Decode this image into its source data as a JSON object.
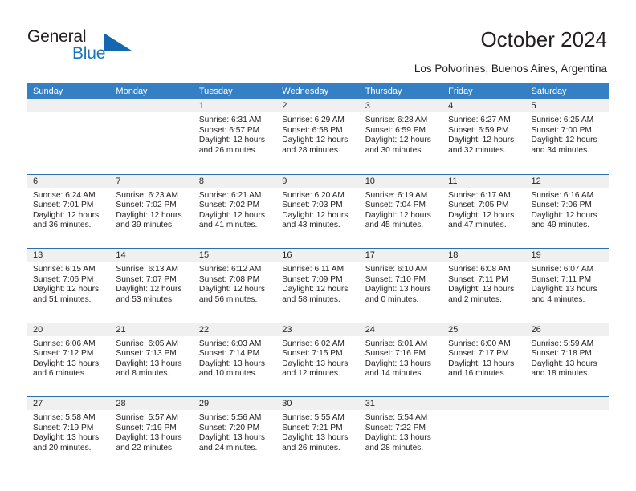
{
  "brand": {
    "name_top": "General",
    "name_bottom": "Blue",
    "triangle_color": "#1667b1",
    "blue_color": "#1b75bb"
  },
  "header": {
    "title": "October 2024",
    "subtitle": "Los Polvorines, Buenos Aires, Argentina"
  },
  "colors": {
    "header_blue": "#3580c4",
    "row_rule_blue": "#2c6fb0",
    "date_band_gray": "#f0f0f0",
    "text": "#231f20"
  },
  "calendar": {
    "weekdays": [
      "Sunday",
      "Monday",
      "Tuesday",
      "Wednesday",
      "Thursday",
      "Friday",
      "Saturday"
    ],
    "weeks": [
      [
        {
          "day": "",
          "sunrise": "",
          "sunset": "",
          "daylight": "",
          "daylight2": ""
        },
        {
          "day": "",
          "sunrise": "",
          "sunset": "",
          "daylight": "",
          "daylight2": ""
        },
        {
          "day": "1",
          "sunrise": "Sunrise: 6:31 AM",
          "sunset": "Sunset: 6:57 PM",
          "daylight": "Daylight: 12 hours",
          "daylight2": "and 26 minutes."
        },
        {
          "day": "2",
          "sunrise": "Sunrise: 6:29 AM",
          "sunset": "Sunset: 6:58 PM",
          "daylight": "Daylight: 12 hours",
          "daylight2": "and 28 minutes."
        },
        {
          "day": "3",
          "sunrise": "Sunrise: 6:28 AM",
          "sunset": "Sunset: 6:59 PM",
          "daylight": "Daylight: 12 hours",
          "daylight2": "and 30 minutes."
        },
        {
          "day": "4",
          "sunrise": "Sunrise: 6:27 AM",
          "sunset": "Sunset: 6:59 PM",
          "daylight": "Daylight: 12 hours",
          "daylight2": "and 32 minutes."
        },
        {
          "day": "5",
          "sunrise": "Sunrise: 6:25 AM",
          "sunset": "Sunset: 7:00 PM",
          "daylight": "Daylight: 12 hours",
          "daylight2": "and 34 minutes."
        }
      ],
      [
        {
          "day": "6",
          "sunrise": "Sunrise: 6:24 AM",
          "sunset": "Sunset: 7:01 PM",
          "daylight": "Daylight: 12 hours",
          "daylight2": "and 36 minutes."
        },
        {
          "day": "7",
          "sunrise": "Sunrise: 6:23 AM",
          "sunset": "Sunset: 7:02 PM",
          "daylight": "Daylight: 12 hours",
          "daylight2": "and 39 minutes."
        },
        {
          "day": "8",
          "sunrise": "Sunrise: 6:21 AM",
          "sunset": "Sunset: 7:02 PM",
          "daylight": "Daylight: 12 hours",
          "daylight2": "and 41 minutes."
        },
        {
          "day": "9",
          "sunrise": "Sunrise: 6:20 AM",
          "sunset": "Sunset: 7:03 PM",
          "daylight": "Daylight: 12 hours",
          "daylight2": "and 43 minutes."
        },
        {
          "day": "10",
          "sunrise": "Sunrise: 6:19 AM",
          "sunset": "Sunset: 7:04 PM",
          "daylight": "Daylight: 12 hours",
          "daylight2": "and 45 minutes."
        },
        {
          "day": "11",
          "sunrise": "Sunrise: 6:17 AM",
          "sunset": "Sunset: 7:05 PM",
          "daylight": "Daylight: 12 hours",
          "daylight2": "and 47 minutes."
        },
        {
          "day": "12",
          "sunrise": "Sunrise: 6:16 AM",
          "sunset": "Sunset: 7:06 PM",
          "daylight": "Daylight: 12 hours",
          "daylight2": "and 49 minutes."
        }
      ],
      [
        {
          "day": "13",
          "sunrise": "Sunrise: 6:15 AM",
          "sunset": "Sunset: 7:06 PM",
          "daylight": "Daylight: 12 hours",
          "daylight2": "and 51 minutes."
        },
        {
          "day": "14",
          "sunrise": "Sunrise: 6:13 AM",
          "sunset": "Sunset: 7:07 PM",
          "daylight": "Daylight: 12 hours",
          "daylight2": "and 53 minutes."
        },
        {
          "day": "15",
          "sunrise": "Sunrise: 6:12 AM",
          "sunset": "Sunset: 7:08 PM",
          "daylight": "Daylight: 12 hours",
          "daylight2": "and 56 minutes."
        },
        {
          "day": "16",
          "sunrise": "Sunrise: 6:11 AM",
          "sunset": "Sunset: 7:09 PM",
          "daylight": "Daylight: 12 hours",
          "daylight2": "and 58 minutes."
        },
        {
          "day": "17",
          "sunrise": "Sunrise: 6:10 AM",
          "sunset": "Sunset: 7:10 PM",
          "daylight": "Daylight: 13 hours",
          "daylight2": "and 0 minutes."
        },
        {
          "day": "18",
          "sunrise": "Sunrise: 6:08 AM",
          "sunset": "Sunset: 7:11 PM",
          "daylight": "Daylight: 13 hours",
          "daylight2": "and 2 minutes."
        },
        {
          "day": "19",
          "sunrise": "Sunrise: 6:07 AM",
          "sunset": "Sunset: 7:11 PM",
          "daylight": "Daylight: 13 hours",
          "daylight2": "and 4 minutes."
        }
      ],
      [
        {
          "day": "20",
          "sunrise": "Sunrise: 6:06 AM",
          "sunset": "Sunset: 7:12 PM",
          "daylight": "Daylight: 13 hours",
          "daylight2": "and 6 minutes."
        },
        {
          "day": "21",
          "sunrise": "Sunrise: 6:05 AM",
          "sunset": "Sunset: 7:13 PM",
          "daylight": "Daylight: 13 hours",
          "daylight2": "and 8 minutes."
        },
        {
          "day": "22",
          "sunrise": "Sunrise: 6:03 AM",
          "sunset": "Sunset: 7:14 PM",
          "daylight": "Daylight: 13 hours",
          "daylight2": "and 10 minutes."
        },
        {
          "day": "23",
          "sunrise": "Sunrise: 6:02 AM",
          "sunset": "Sunset: 7:15 PM",
          "daylight": "Daylight: 13 hours",
          "daylight2": "and 12 minutes."
        },
        {
          "day": "24",
          "sunrise": "Sunrise: 6:01 AM",
          "sunset": "Sunset: 7:16 PM",
          "daylight": "Daylight: 13 hours",
          "daylight2": "and 14 minutes."
        },
        {
          "day": "25",
          "sunrise": "Sunrise: 6:00 AM",
          "sunset": "Sunset: 7:17 PM",
          "daylight": "Daylight: 13 hours",
          "daylight2": "and 16 minutes."
        },
        {
          "day": "26",
          "sunrise": "Sunrise: 5:59 AM",
          "sunset": "Sunset: 7:18 PM",
          "daylight": "Daylight: 13 hours",
          "daylight2": "and 18 minutes."
        }
      ],
      [
        {
          "day": "27",
          "sunrise": "Sunrise: 5:58 AM",
          "sunset": "Sunset: 7:19 PM",
          "daylight": "Daylight: 13 hours",
          "daylight2": "and 20 minutes."
        },
        {
          "day": "28",
          "sunrise": "Sunrise: 5:57 AM",
          "sunset": "Sunset: 7:19 PM",
          "daylight": "Daylight: 13 hours",
          "daylight2": "and 22 minutes."
        },
        {
          "day": "29",
          "sunrise": "Sunrise: 5:56 AM",
          "sunset": "Sunset: 7:20 PM",
          "daylight": "Daylight: 13 hours",
          "daylight2": "and 24 minutes."
        },
        {
          "day": "30",
          "sunrise": "Sunrise: 5:55 AM",
          "sunset": "Sunset: 7:21 PM",
          "daylight": "Daylight: 13 hours",
          "daylight2": "and 26 minutes."
        },
        {
          "day": "31",
          "sunrise": "Sunrise: 5:54 AM",
          "sunset": "Sunset: 7:22 PM",
          "daylight": "Daylight: 13 hours",
          "daylight2": "and 28 minutes."
        },
        {
          "day": "",
          "sunrise": "",
          "sunset": "",
          "daylight": "",
          "daylight2": ""
        },
        {
          "day": "",
          "sunrise": "",
          "sunset": "",
          "daylight": "",
          "daylight2": ""
        }
      ]
    ]
  }
}
